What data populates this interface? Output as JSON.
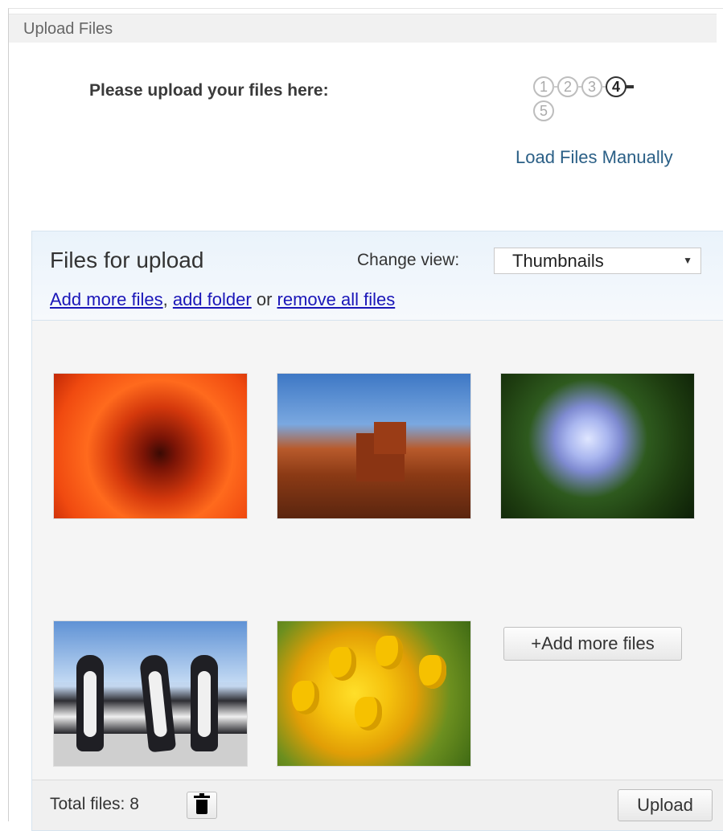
{
  "panel": {
    "title": "Upload Files"
  },
  "intro": {
    "text": "Please upload your files here:"
  },
  "steps": {
    "items": [
      "1",
      "2",
      "3",
      "4",
      "5"
    ],
    "active": "4"
  },
  "manual_link": {
    "label": "Load Files Manually"
  },
  "upload": {
    "title": "Files for upload",
    "change_view_label": "Change view:",
    "view_selected": "Thumbnails",
    "links": {
      "add_files": "Add more files",
      "separator1": ", ",
      "add_folder": "add folder",
      "separator2": " or ",
      "remove_all": "remove all files"
    },
    "thumbnails": [
      {
        "subject": "orange flower"
      },
      {
        "subject": "desert mesa"
      },
      {
        "subject": "hydrangea"
      },
      {
        "subject": "penguins"
      },
      {
        "subject": "yellow tulips"
      }
    ],
    "add_more_button": "+Add more files",
    "footer": {
      "total_label": "Total files: 8",
      "upload_button": "Upload"
    }
  },
  "colors": {
    "link": "#1a16b8",
    "manual_link": "#2a5f86",
    "header_bg": "#eaf3fb"
  }
}
